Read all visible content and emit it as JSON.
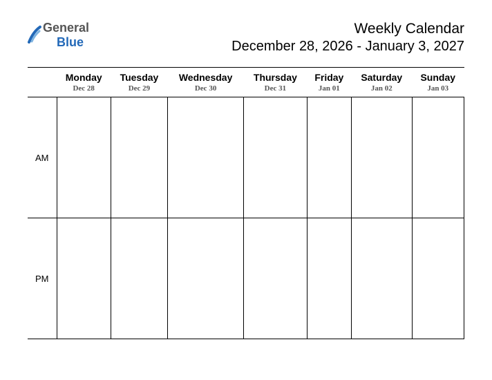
{
  "logo": {
    "word1": "General",
    "word2": "Blue",
    "color1": "#555555",
    "color2": "#2369b8"
  },
  "header": {
    "title": "Weekly Calendar",
    "date_range": "December 28, 2026 - January 3, 2027"
  },
  "days": [
    {
      "name": "Monday",
      "date": "Dec 28"
    },
    {
      "name": "Tuesday",
      "date": "Dec 29"
    },
    {
      "name": "Wednesday",
      "date": "Dec 30"
    },
    {
      "name": "Thursday",
      "date": "Dec 31"
    },
    {
      "name": "Friday",
      "date": "Jan 01"
    },
    {
      "name": "Saturday",
      "date": "Jan 02"
    },
    {
      "name": "Sunday",
      "date": "Jan 03"
    }
  ],
  "rows": {
    "am": "AM",
    "pm": "PM"
  }
}
